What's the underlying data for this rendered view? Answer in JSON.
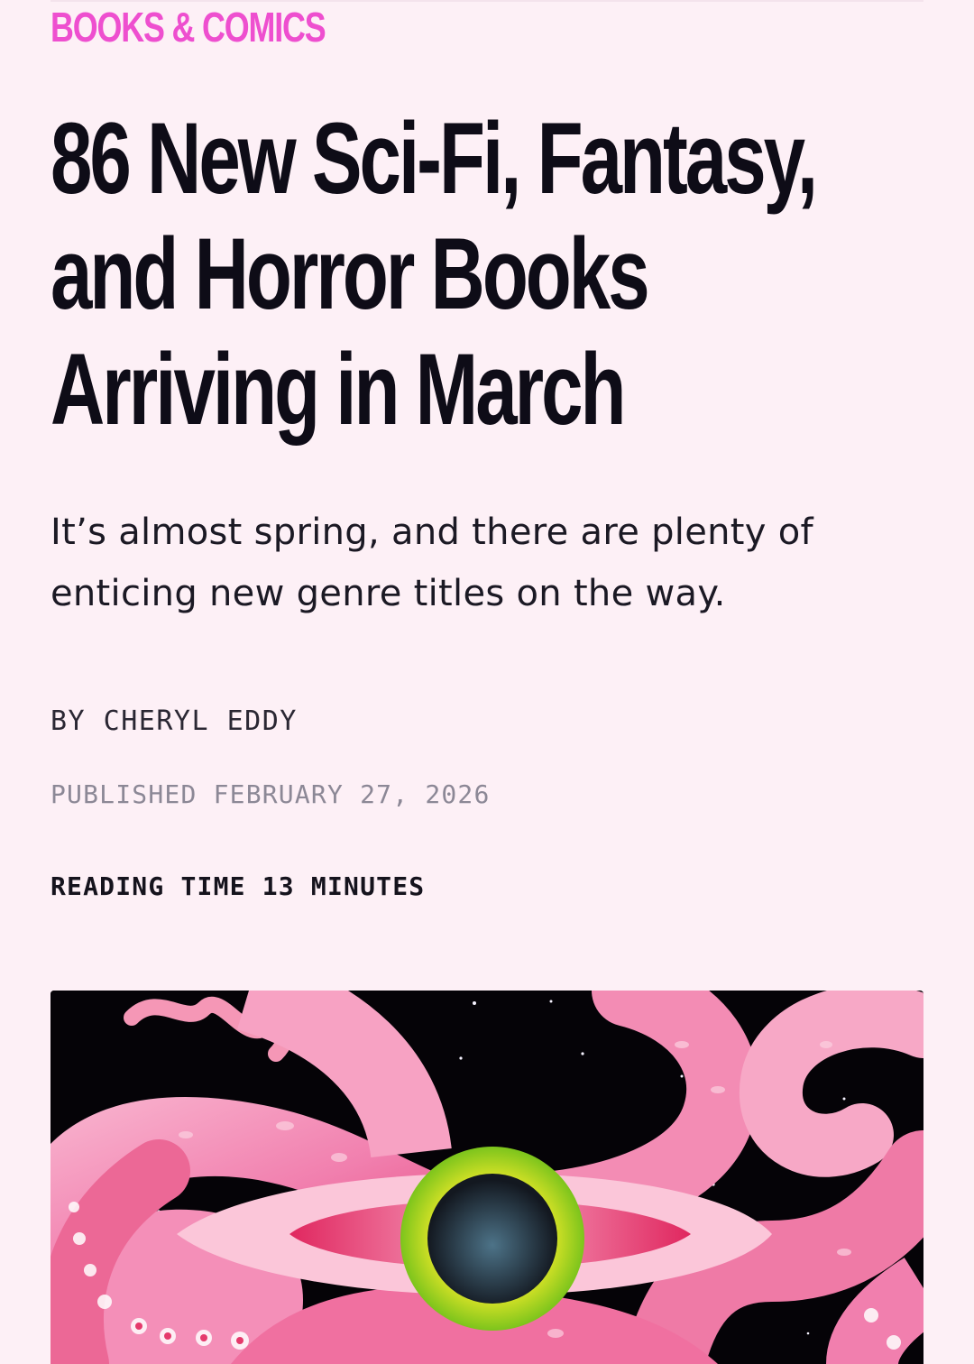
{
  "article": {
    "category": "BOOKS & COMICS",
    "headline_lines": [
      "86 New Sci-Fi, Fantasy,",
      "and Horror Books",
      "Arriving in March"
    ],
    "dek_lines": [
      "It’s almost spring, and there are plenty of",
      "enticing new genre titles on the way."
    ],
    "byline": "BY CHERYL EDDY",
    "published": "PUBLISHED FEBRUARY 27, 2026",
    "reading_time": "READING TIME 13 MINUTES"
  },
  "hero_image": {
    "subject": "illustration of pink tentacles surrounding a staring eye against a starry black sky",
    "colors": {
      "background": "#050307",
      "tentacle": "#f48fb8",
      "tentacle_dark": "#e8457a",
      "iris_outer": "#9ad21f",
      "iris_inner": "#f6ec2a",
      "pupil": "#1c2530"
    }
  },
  "theme": {
    "page_background": "#fdf0f6",
    "accent": "#ee4fcf",
    "text": "#0e0c17",
    "muted": "#8c8896"
  }
}
